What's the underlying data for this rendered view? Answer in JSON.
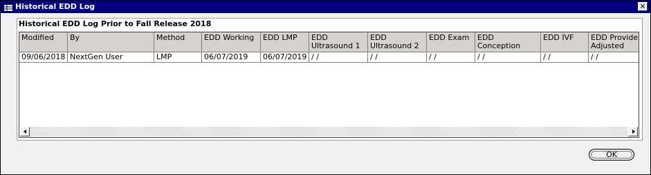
{
  "window": {
    "title": "Historical EDD Log",
    "close_glyph": "✕"
  },
  "group": {
    "title": "Historical EDD Log Prior to Fall Release 2018"
  },
  "table": {
    "columns": [
      "Modified",
      "By",
      "Method",
      "EDD Working",
      "EDD LMP",
      "EDD Ultrasound 1",
      "EDD Ultrasound 2",
      "EDD Exam",
      "EDD Conception",
      "EDD IVF",
      "EDD Provider Adjusted"
    ],
    "rows": [
      [
        "09/06/2018",
        "NextGen User",
        "LMP",
        "06/07/2019",
        "06/07/2019",
        " / /",
        " / /",
        " / /",
        " / /",
        " / /",
        " / /"
      ]
    ]
  },
  "buttons": {
    "ok_label": "OK"
  },
  "icons": {
    "title_icon": "grid-window-icon",
    "close_icon": "close-icon",
    "scroll_left": "chevron-left-icon",
    "scroll_right": "chevron-right-icon"
  }
}
